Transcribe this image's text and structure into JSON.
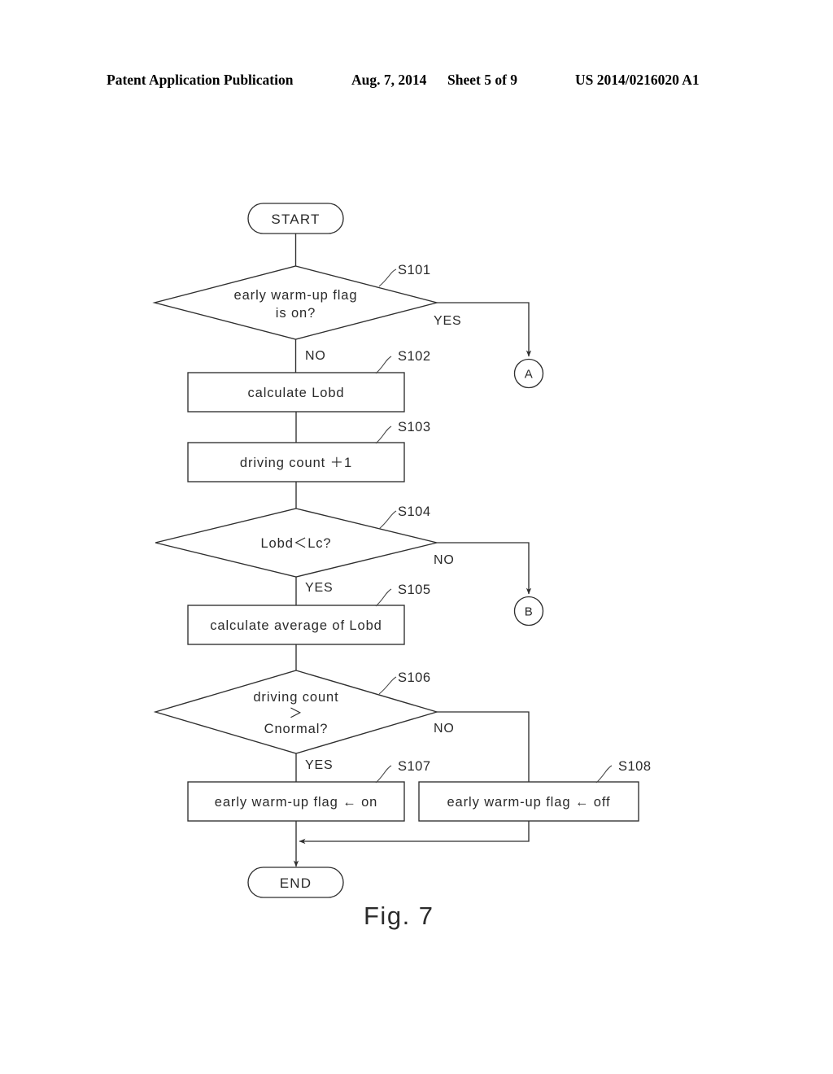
{
  "header": {
    "publication": "Patent Application Publication",
    "date": "Aug. 7, 2014",
    "sheet": "Sheet 5 of 9",
    "patent_number": "US 2014/0216020 A1"
  },
  "figure": {
    "caption": "Fig. 7"
  },
  "flowchart": {
    "start_label": "START",
    "end_label": "END",
    "nodes": [
      {
        "id": "S101",
        "step": "S101",
        "type": "decision",
        "text_line1": "early warm-up flag",
        "text_line2": "is on?"
      },
      {
        "id": "S102",
        "step": "S102",
        "type": "process",
        "text": "calculate Lobd"
      },
      {
        "id": "S103",
        "step": "S103",
        "type": "process",
        "text": "driving count ＋1"
      },
      {
        "id": "S104",
        "step": "S104",
        "type": "decision",
        "text": "Lobd＜Lc?"
      },
      {
        "id": "S105",
        "step": "S105",
        "type": "process",
        "text": "calculate average of Lobd"
      },
      {
        "id": "S106",
        "step": "S106",
        "type": "decision",
        "text_line1": "driving count",
        "text_line2": "＞",
        "text_line3": "Cnormal?"
      },
      {
        "id": "S107",
        "step": "S107",
        "type": "process",
        "text": "early warm-up flag ← on"
      },
      {
        "id": "S108",
        "step": "S108",
        "type": "process",
        "text": "early warm-up flag ← off"
      }
    ],
    "connectors": [
      {
        "id": "A",
        "label": "A"
      },
      {
        "id": "B",
        "label": "B"
      }
    ],
    "branch_labels": {
      "s101_yes": "YES",
      "s101_no": "NO",
      "s104_no": "NO",
      "s104_yes": "YES",
      "s106_no": "NO",
      "s106_yes": "YES"
    }
  },
  "colors": {
    "line": "#2f2f2f",
    "text": "#2a2a2a",
    "background": "#ffffff"
  }
}
